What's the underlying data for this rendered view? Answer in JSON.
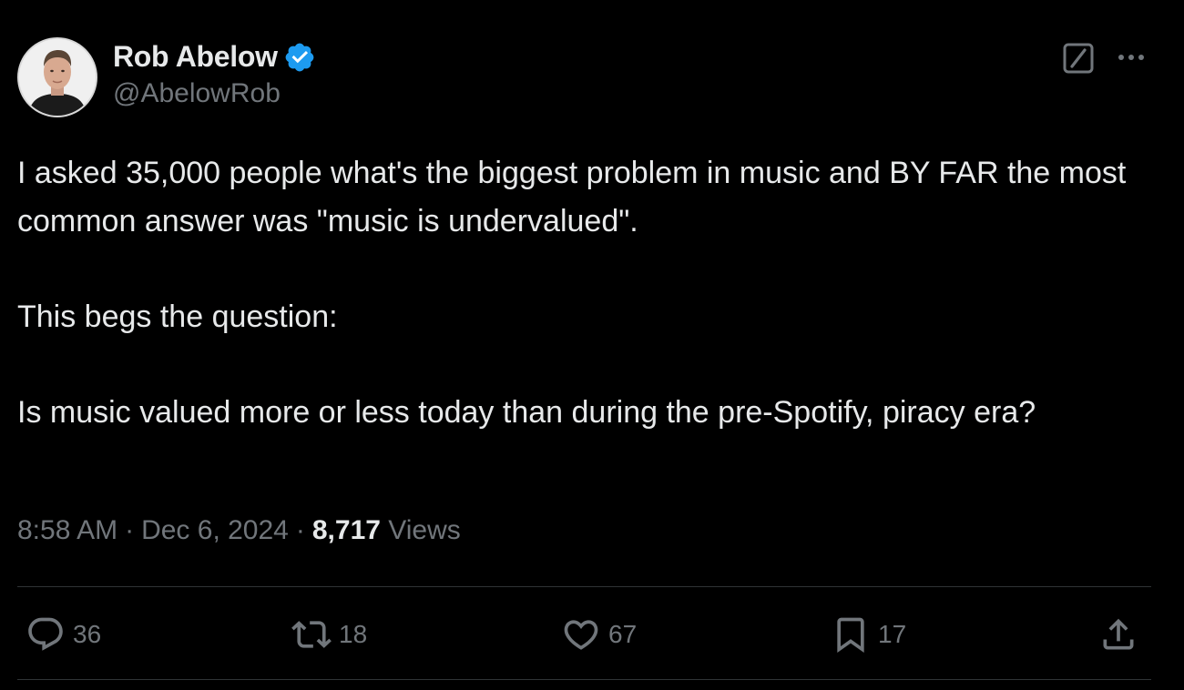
{
  "author": {
    "name": "Rob Abelow",
    "handle": "@AbelowRob",
    "verified_icon": "verified-badge-icon",
    "verified_color": "#1d9bf0"
  },
  "header_actions": {
    "grok_icon": "grok-icon",
    "more_icon": "more-icon"
  },
  "tweet": {
    "paragraphs": [
      "I asked 35,000 people what's the biggest problem in music and BY FAR the most common answer was \"music is undervalued\".",
      "This begs the question:",
      "Is music valued more or less today than during the pre-Spotify, piracy era?"
    ]
  },
  "meta": {
    "time": "8:58 AM",
    "separator": "·",
    "date": "Dec 6, 2024",
    "views_count": "8,717",
    "views_label": "Views"
  },
  "actions": {
    "replies": "36",
    "reposts": "18",
    "likes": "67",
    "bookmarks": "17",
    "share_icon": "share-icon"
  },
  "colors": {
    "background": "#000000",
    "text_primary": "#e7e9ea",
    "text_secondary": "#71767b",
    "divider": "#2f3336",
    "accent": "#1d9bf0"
  }
}
